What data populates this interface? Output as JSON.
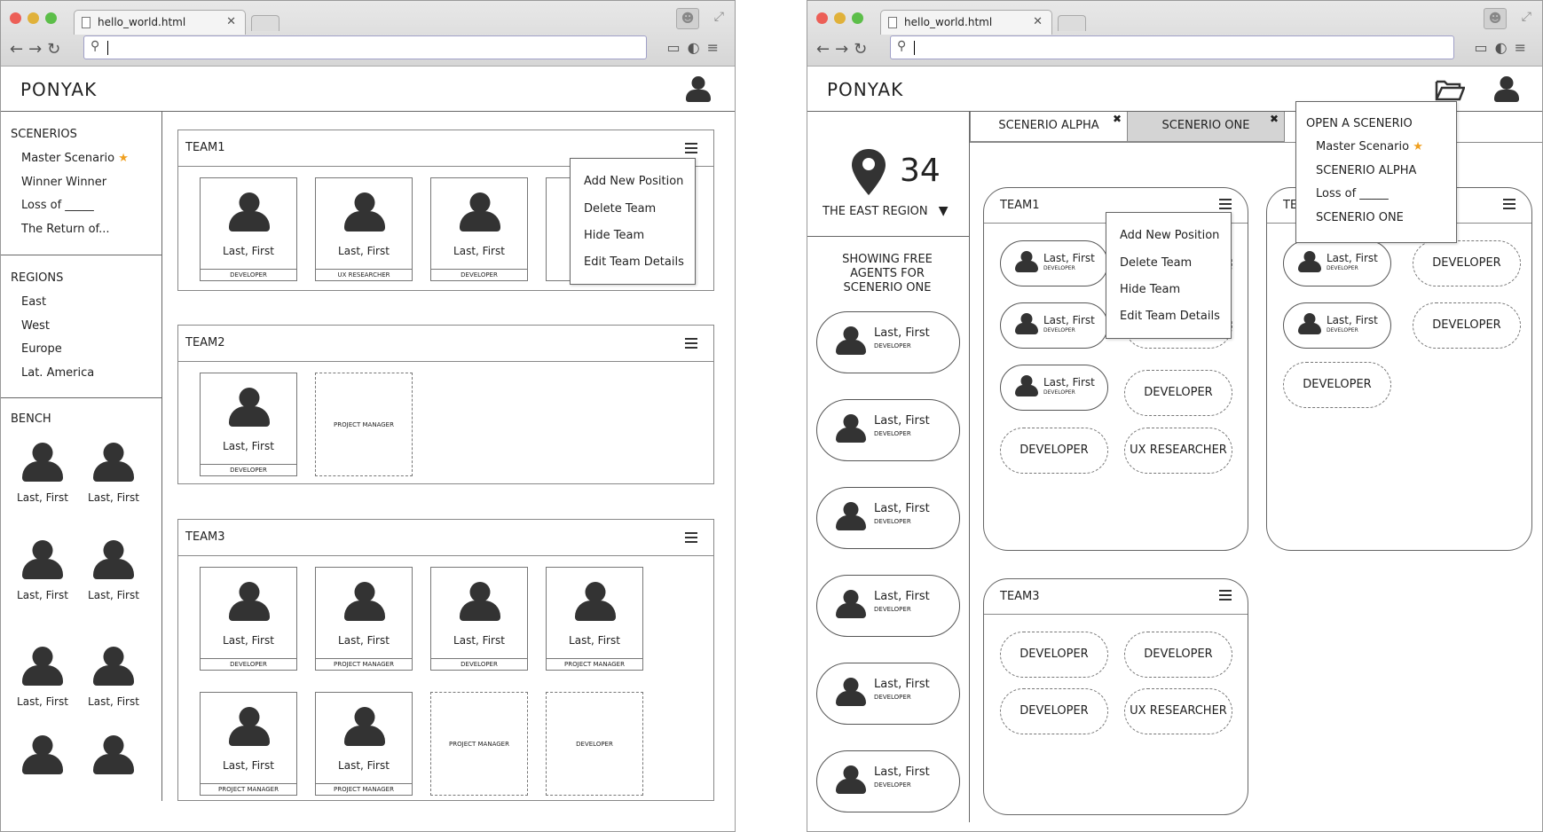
{
  "left": {
    "browser": {
      "tab_title": "hello_world.html"
    },
    "app": {
      "logo": "PONYAK"
    },
    "scenarios": {
      "heading": "SCENERIOS",
      "items": [
        "Master Scenario",
        "Winner Winner",
        "Loss of _____",
        "The Return of..."
      ]
    },
    "regions": {
      "heading": "REGIONS",
      "items": [
        "East",
        "West",
        "Europe",
        "Lat. America"
      ]
    },
    "bench": {
      "heading": "BENCH",
      "people": [
        "Last, First",
        "Last, First",
        "Last, First",
        "Last, First",
        "Last, First",
        "Last, First"
      ]
    },
    "teams": [
      {
        "name": "TEAM1",
        "cards": [
          {
            "name": "Last, First",
            "role": "DEVELOPER"
          },
          {
            "name": "Last, First",
            "role": "UX RESEARCHER"
          },
          {
            "name": "Last, First",
            "role": "DEVELOPER"
          }
        ]
      },
      {
        "name": "TEAM2",
        "cards": [
          {
            "name": "Last, First",
            "role": "DEVELOPER"
          }
        ],
        "open": [
          "PROJECT MANAGER"
        ]
      },
      {
        "name": "TEAM3",
        "cards": [
          {
            "name": "Last, First",
            "role": "DEVELOPER"
          },
          {
            "name": "Last, First",
            "role": "PROJECT MANAGER"
          },
          {
            "name": "Last, First",
            "role": "DEVELOPER"
          },
          {
            "name": "Last, First",
            "role": "PROJECT MANAGER"
          },
          {
            "name": "Last, First",
            "role": "PROJECT MANAGER"
          },
          {
            "name": "Last, First",
            "role": "PROJECT MANAGER"
          }
        ],
        "open": [
          "PROJECT MANAGER",
          "DEVELOPER"
        ]
      }
    ],
    "team_menu": [
      "Add New Position",
      "Delete Team",
      "Hide Team",
      "Edit Team Details"
    ]
  },
  "right": {
    "browser": {
      "tab_title": "hello_world.html"
    },
    "app": {
      "logo": "PONYAK"
    },
    "region": {
      "count": "34",
      "name": "THE EAST REGION"
    },
    "free_agents": {
      "heading": "SHOWING FREE AGENTS FOR SCENERIO ONE",
      "name": "Last, First",
      "role": "DEVELOPER"
    },
    "scenario_tabs": [
      "SCENERIO ALPHA",
      "SCENERIO ONE"
    ],
    "open_menu": {
      "heading": "OPEN A SCENERIO",
      "items": [
        "Master Scenario",
        "SCENERIO ALPHA",
        "Loss of _____",
        "SCENERIO ONE"
      ]
    },
    "team_menu": [
      "Add New Position",
      "Delete Team",
      "Hide Team",
      "Edit Team Details"
    ],
    "team1": {
      "name": "TEAM1",
      "person": "Last, First",
      "role": "DEVELOPER",
      "open": [
        "DEVELOPER",
        "DEVELOPER",
        "UX RESEARCHER"
      ]
    },
    "team2": {
      "name": "TE",
      "person": "Last, First",
      "role": "DEVELOPER",
      "open": [
        "DEVELOPER",
        "DEVELOPER",
        "DEVELOPER"
      ]
    },
    "team3": {
      "name": "TEAM3",
      "open": [
        "DEVELOPER",
        "DEVELOPER",
        "DEVELOPER",
        "UX RESEARCHER"
      ]
    }
  },
  "colors": {
    "star": "#f0a020",
    "icon": "#333333"
  }
}
